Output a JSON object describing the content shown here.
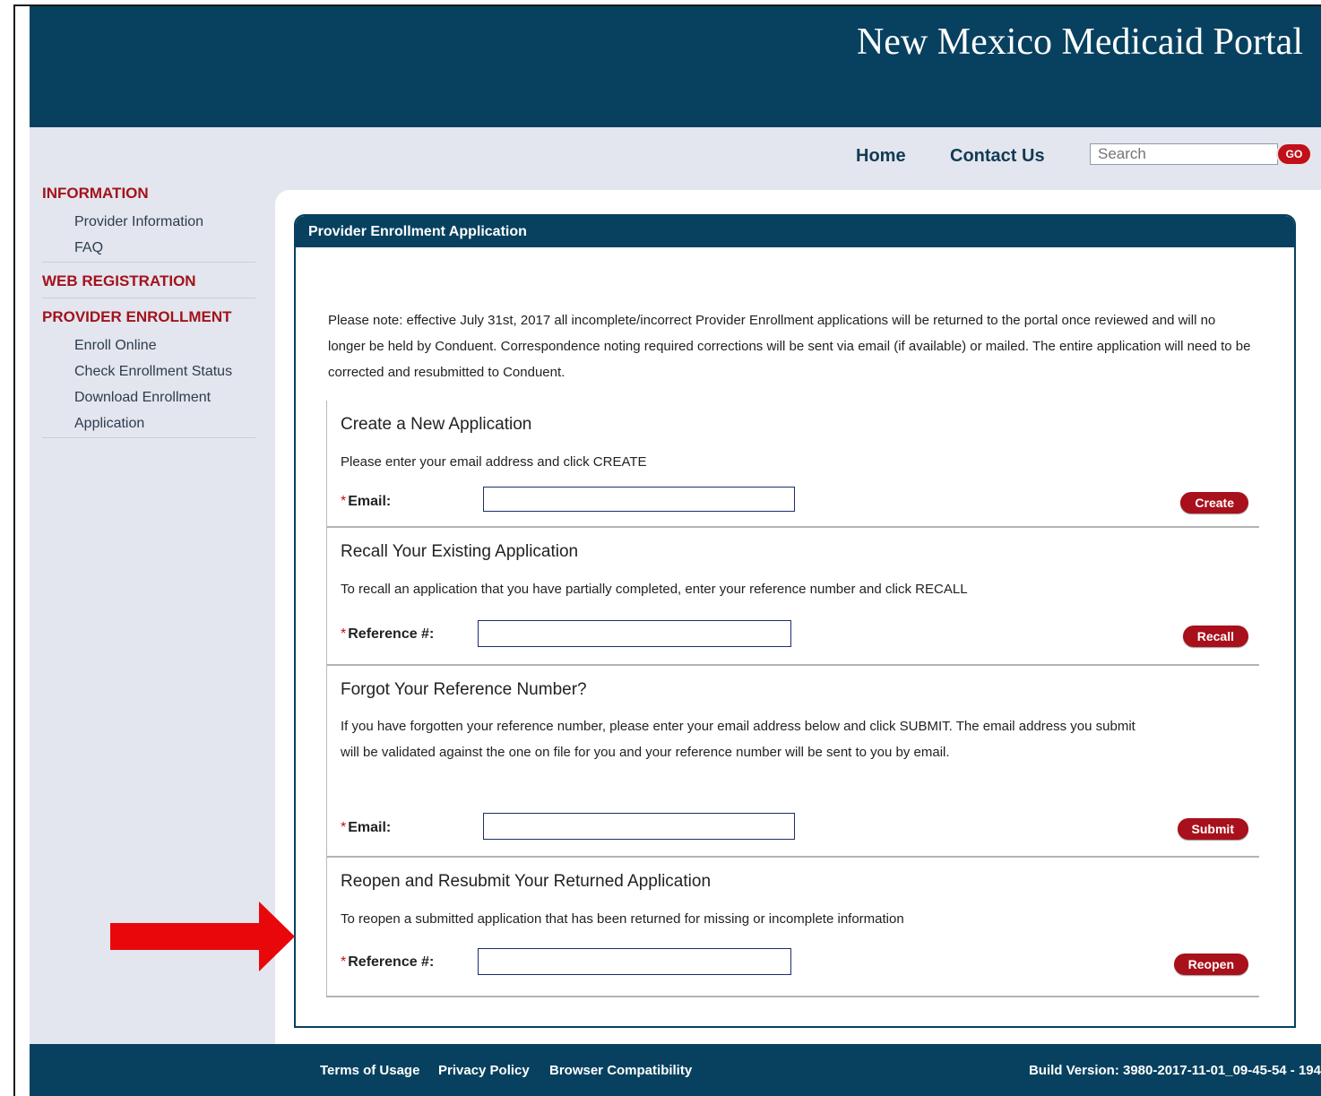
{
  "header": {
    "title": "New Mexico Medicaid Portal"
  },
  "topnav": {
    "home": "Home",
    "contact": "Contact Us",
    "search_placeholder": "Search",
    "go_label": "GO"
  },
  "sidebar": {
    "sections": [
      {
        "label": "INFORMATION",
        "items": [
          "Provider Information",
          "FAQ"
        ]
      },
      {
        "label": "WEB REGISTRATION",
        "items": []
      },
      {
        "label": "PROVIDER ENROLLMENT",
        "items": [
          "Enroll Online",
          "Check Enrollment Status",
          "Download Enrollment",
          "Application"
        ]
      }
    ]
  },
  "panel": {
    "title": "Provider Enrollment Application",
    "notice": "Please note: effective July 31st, 2017 all incomplete/incorrect Provider Enrollment applications will be returned to the portal once reviewed and will no longer be held by Conduent. Correspondence noting required corrections will be sent via email (if available) or mailed. The entire application will need to be corrected and resubmitted to Conduent.",
    "create": {
      "title": "Create a New Application",
      "desc": "Please enter your email address and click CREATE",
      "label": "Email:",
      "value": "",
      "button": "Create"
    },
    "recall": {
      "title": "Recall Your Existing Application",
      "desc": "To recall an application that you have partially completed, enter your reference number and click RECALL",
      "label": "Reference #:",
      "value": "",
      "button": "Recall"
    },
    "forgot": {
      "title": "Forgot Your Reference Number?",
      "desc": "If you have forgotten your reference number, please enter your email address below and click SUBMIT. The email address you submit will be validated against the one on file for you and your reference number will be sent to you by email.",
      "label": "Email:",
      "value": "",
      "button": "Submit"
    },
    "reopen": {
      "title": "Reopen and Resubmit Your Returned Application",
      "desc": "To reopen a submitted application that has been returned for missing or incomplete information",
      "label": "Reference #:",
      "value": "",
      "button": "Reopen"
    }
  },
  "footer": {
    "terms": "Terms of Usage",
    "privacy": "Privacy Policy",
    "browser": "Browser Compatibility",
    "build": "Build Version: 3980-2017-11-01_09-45-54 - 194"
  },
  "colors": {
    "header_bg": "#07415f",
    "accent_red": "#a8101b",
    "sidebar_section": "#a3121c",
    "annotation_arrow": "#e8080c"
  },
  "icons": [
    "arrow-right-annotation-icon"
  ]
}
